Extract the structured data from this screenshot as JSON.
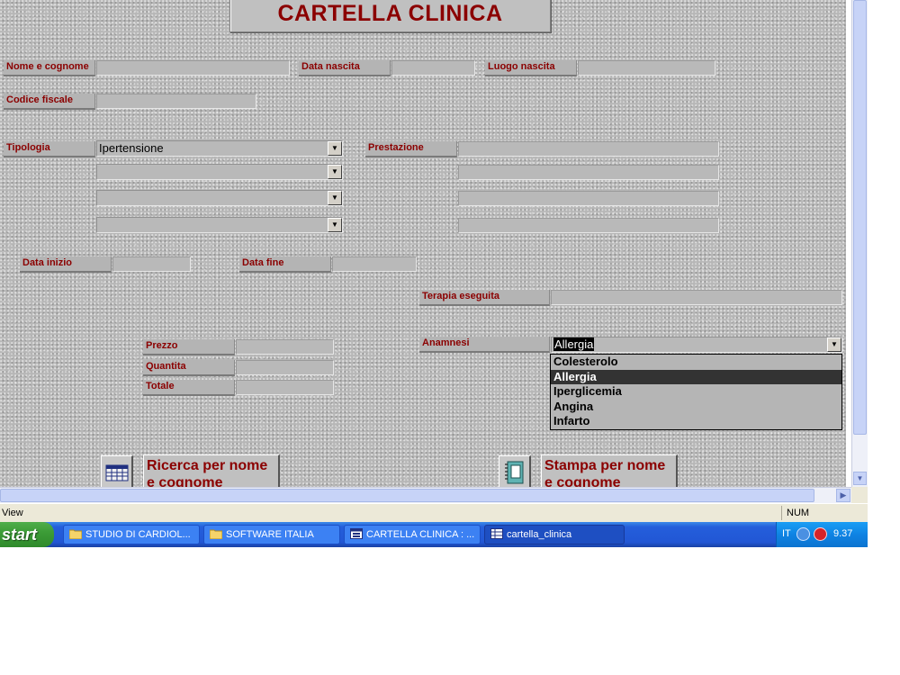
{
  "form": {
    "title": "CARTELLA CLINICA",
    "labels": {
      "nome": "Nome e cognome",
      "data_nascita": "Data nascita",
      "luogo_nascita": "Luogo nascita",
      "codice_fiscale": "Codice fiscale",
      "tipologia": "Tipologia",
      "prestazione": "Prestazione",
      "data_inizio": "Data inizio",
      "data_fine": "Data fine",
      "terapia": "Terapia eseguita",
      "prezzo": "Prezzo",
      "quantita": "Quantita",
      "totale": "Totale",
      "anamnesi": "Anamnesi"
    },
    "tipologia_value": "Ipertensione",
    "anamnesi_value": "Allergia",
    "anamnesi_options": [
      "Colesterolo",
      "Allergia",
      "Iperglicemia",
      "Angina",
      "Infarto"
    ],
    "anamnesi_highlighted": "Allergia",
    "buttons": {
      "ricerca": "Ricerca per nome e cognome",
      "stampa": "Stampa per nome e cognome"
    }
  },
  "statusbar": {
    "left": "View",
    "right": "NUM"
  },
  "taskbar": {
    "start": "start",
    "tasks": [
      {
        "label": "STUDIO DI CARDIOL...",
        "icon": "folder-icon"
      },
      {
        "label": "SOFTWARE ITALIA",
        "icon": "folder-icon"
      },
      {
        "label": "CARTELLA CLINICA : ...",
        "icon": "access-form-icon"
      },
      {
        "label": "cartella_clinica",
        "icon": "access-table-icon"
      }
    ],
    "tray": {
      "lang": "IT",
      "clock": "9.37"
    }
  },
  "colors": {
    "label_text": "#8b0000",
    "taskbar": "#245edb",
    "start_button": "#3c9c37"
  }
}
